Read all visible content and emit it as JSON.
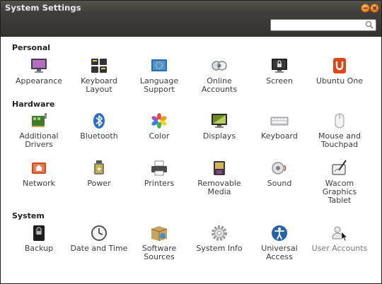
{
  "window": {
    "title": "System Settings"
  },
  "search": {
    "value": "",
    "placeholder": ""
  },
  "sections": {
    "personal": {
      "title": "Personal",
      "items": [
        {
          "label": "Appearance",
          "icon": "appearance-icon"
        },
        {
          "label": "Keyboard Layout",
          "icon": "keyboard-layout-icon"
        },
        {
          "label": "Language Support",
          "icon": "language-support-icon"
        },
        {
          "label": "Online Accounts",
          "icon": "online-accounts-icon"
        },
        {
          "label": "Screen",
          "icon": "screen-icon"
        },
        {
          "label": "Ubuntu One",
          "icon": "ubuntu-one-icon"
        }
      ]
    },
    "hardware": {
      "title": "Hardware",
      "items": [
        {
          "label": "Additional Drivers",
          "icon": "additional-drivers-icon"
        },
        {
          "label": "Bluetooth",
          "icon": "bluetooth-icon"
        },
        {
          "label": "Color",
          "icon": "color-icon"
        },
        {
          "label": "Displays",
          "icon": "displays-icon"
        },
        {
          "label": "Keyboard",
          "icon": "keyboard-icon"
        },
        {
          "label": "Mouse and Touchpad",
          "icon": "mouse-icon"
        },
        {
          "label": "Network",
          "icon": "network-icon"
        },
        {
          "label": "Power",
          "icon": "power-icon"
        },
        {
          "label": "Printers",
          "icon": "printer-icon"
        },
        {
          "label": "Removable Media",
          "icon": "removable-media-icon"
        },
        {
          "label": "Sound",
          "icon": "sound-icon"
        },
        {
          "label": "Wacom Graphics Tablet",
          "icon": "wacom-tablet-icon"
        }
      ]
    },
    "system": {
      "title": "System",
      "items": [
        {
          "label": "Backup",
          "icon": "backup-icon"
        },
        {
          "label": "Date and Time",
          "icon": "clock-icon"
        },
        {
          "label": "Software Sources",
          "icon": "software-sources-icon"
        },
        {
          "label": "System Info",
          "icon": "gear-icon"
        },
        {
          "label": "Universal Access",
          "icon": "universal-access-icon"
        },
        {
          "label": "User Accounts",
          "icon": "user-accounts-icon"
        }
      ]
    }
  },
  "colors": {
    "titlebar": "#3c3b37",
    "window_buttons": "#e87a14",
    "ubuntu_orange": "#dd4814",
    "background": "#ffffff"
  }
}
